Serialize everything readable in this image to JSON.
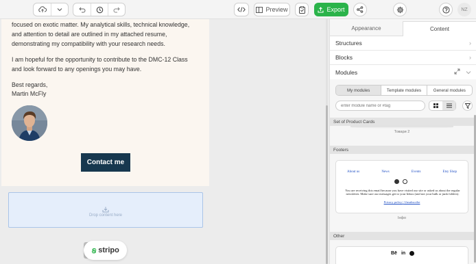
{
  "toolbar": {
    "preview_label": "Preview",
    "export_label": "Export",
    "user_initials": "NZ",
    "icons": [
      "cloud-upload-icon",
      "chevron-down-icon",
      "undo-icon",
      "history-icon",
      "redo-icon",
      "code-icon",
      "preview-icon",
      "checklist-icon",
      "export-icon",
      "share-icon",
      "gear-icon",
      "help-icon"
    ]
  },
  "email": {
    "paragraph1": [
      "focused on exotic matter. My analytical skills, technical knowledge,",
      "and attention to detail are outlined in my attached resume,",
      "demonstrating my compatibility with your research needs."
    ],
    "paragraph2": [
      "I am hopeful for the opportunity to contribute to the DMC-12 Class",
      "and look forward to any openings you may have."
    ],
    "closing": "Best regards,",
    "signature": "Martin McFly",
    "button_label": "Contact me",
    "button_color": "#17384f",
    "background": "#fbf6f0"
  },
  "dropzone": {
    "label": "Drop content here"
  },
  "branding": {
    "logo_text": "stripo",
    "accent": "#2bb34a"
  },
  "panel": {
    "tabs": [
      {
        "label": "Appearance",
        "active": false
      },
      {
        "label": "Content",
        "active": true
      }
    ],
    "sections": {
      "structures": "Structures",
      "blocks": "Blocks",
      "modules": "Modules"
    },
    "module_tabs": [
      "My modules",
      "Template modules",
      "General modules"
    ],
    "search_placeholder": "enter module name or #tag",
    "groups": {
      "product_cards": {
        "title": "Set of Product Cards",
        "item_label": "Товари 2"
      },
      "footers": {
        "title": "Footers",
        "links": [
          "About us",
          "News",
          "Events",
          "Etsy Shop"
        ],
        "notice": "You are receiving this email because you have visited our site or asked us about the regular newsletter. Make sure our messages get to your Inbox (and not your bulk or junk folders).",
        "policy_link": "Privacy policy",
        "separator": "|",
        "unsubscribe_link": "Unsubscribe",
        "item_label": "Інфо"
      },
      "other": {
        "title": "Other",
        "social_text": "Bē"
      }
    }
  }
}
